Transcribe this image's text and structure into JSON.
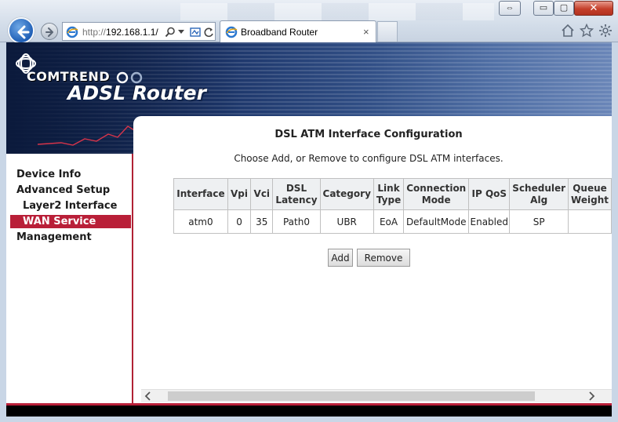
{
  "browser": {
    "address": {
      "protocol": "http://",
      "host": "192.168.1.1/"
    },
    "tab_title": "Broadband Router",
    "tab_close": "×",
    "window_buttons": {
      "restore_arrows": "⇔",
      "minimize": "▭",
      "maximize": "▢",
      "close": "✕"
    }
  },
  "banner": {
    "logo": "COMTREND",
    "title": "ADSL Router"
  },
  "sidebar": {
    "items": [
      {
        "label": "Device Info"
      },
      {
        "label": "Advanced Setup"
      },
      {
        "label": "Layer2 Interface"
      },
      {
        "label": "WAN Service"
      },
      {
        "label": "Management"
      }
    ]
  },
  "main": {
    "title": "DSL ATM Interface Configuration",
    "description": "Choose Add, or Remove to configure DSL ATM interfaces.",
    "table": {
      "headers": [
        [
          "Interface"
        ],
        [
          "Vpi"
        ],
        [
          "Vci"
        ],
        [
          "DSL",
          "Latency"
        ],
        [
          "Category"
        ],
        [
          "Link",
          "Type"
        ],
        [
          "Connection",
          "Mode"
        ],
        [
          "IP QoS"
        ],
        [
          "Scheduler",
          "Alg"
        ],
        [
          "Queue",
          "Weight"
        ]
      ],
      "rows": [
        [
          "atm0",
          "0",
          "35",
          "Path0",
          "UBR",
          "EoA",
          "DefaultMode",
          "Enabled",
          "SP",
          ""
        ]
      ]
    },
    "buttons": {
      "add": "Add",
      "remove": "Remove"
    }
  },
  "colors": {
    "accent": "#b91f38",
    "banner_dark": "#0f2149",
    "banner_light": "#6a86b8"
  }
}
